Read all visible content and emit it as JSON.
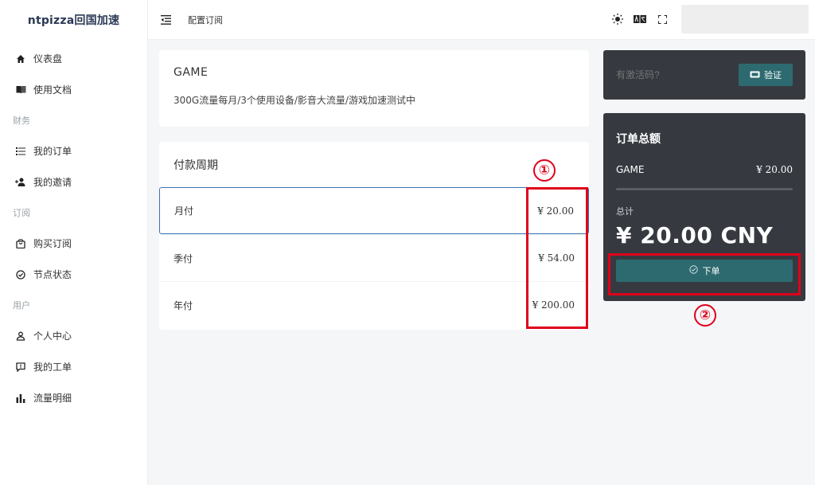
{
  "brand": "ntpizza回国加速",
  "breadcrumb": "配置订阅",
  "sidebar": {
    "items": [
      {
        "id": "dashboard",
        "label": "仪表盘"
      },
      {
        "id": "docs",
        "label": "使用文档"
      },
      {
        "id": "sec-finance",
        "label": "财务"
      },
      {
        "id": "orders",
        "label": "我的订单"
      },
      {
        "id": "invite",
        "label": "我的邀请"
      },
      {
        "id": "sec-sub",
        "label": "订阅"
      },
      {
        "id": "buy",
        "label": "购买订阅"
      },
      {
        "id": "nodes",
        "label": "节点状态"
      },
      {
        "id": "sec-user",
        "label": "用户"
      },
      {
        "id": "profile",
        "label": "个人中心"
      },
      {
        "id": "tickets",
        "label": "我的工单"
      },
      {
        "id": "traffic",
        "label": "流量明细"
      }
    ]
  },
  "plan": {
    "title": "GAME",
    "description": "300G流量每月/3个使用设备/影音大流量/游戏加速测试中"
  },
  "period": {
    "title": "付款周期",
    "options": [
      {
        "label": "月付",
        "price": "¥ 20.00",
        "selected": true
      },
      {
        "label": "季付",
        "price": "¥ 54.00",
        "selected": false
      },
      {
        "label": "年付",
        "price": "¥ 200.00",
        "selected": false
      }
    ]
  },
  "coupon": {
    "placeholder": "有激活码?",
    "button": "验证"
  },
  "summary": {
    "title": "订单总额",
    "item_name": "GAME",
    "item_price": "¥ 20.00",
    "total_label": "总计",
    "total_value": "¥ 20.00 CNY",
    "order_button": "下单"
  },
  "annotations": {
    "one": "①",
    "two": "②"
  },
  "colors": {
    "accent": "#2d6a70",
    "panel_dark": "#363a40",
    "annotation_red": "#e0001a",
    "selected_border": "#3b73b5"
  }
}
